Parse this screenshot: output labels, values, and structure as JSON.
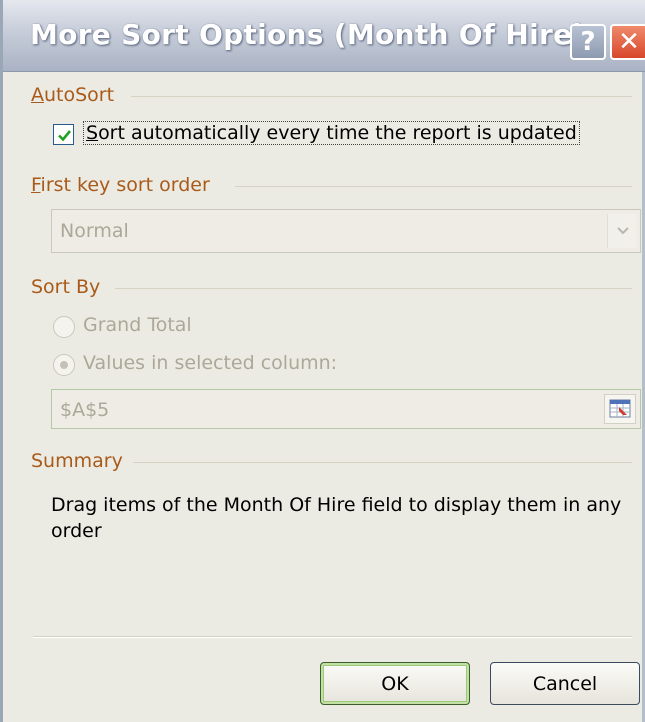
{
  "window": {
    "title": "More Sort Options (Month Of Hire)",
    "help_glyph": "?",
    "close_glyph": "✕"
  },
  "autosort": {
    "group_label_prefix": "",
    "group_label_accel": "A",
    "group_label_rest": "utoSort",
    "checkbox_checked": true,
    "checkbox_label_accel": "S",
    "checkbox_label_rest": "ort automatically every time the report is updated"
  },
  "first_key": {
    "group_label_accel": "F",
    "group_label_rest": "irst key sort order",
    "selected_value": "Normal",
    "disabled": true
  },
  "sort_by": {
    "group_label": "Sort By",
    "options": [
      {
        "label": "Grand Total",
        "selected": false
      },
      {
        "label": "Values in selected column:",
        "selected": true
      }
    ],
    "range_value": "$A$5"
  },
  "summary": {
    "group_label": "Summary",
    "text": "Drag items of the Month Of Hire field to display them in any order"
  },
  "buttons": {
    "ok": "OK",
    "cancel": "Cancel"
  },
  "colors": {
    "group_label": "#a85a1a",
    "disabled_text": "#aca899",
    "close_button": "#d8472a"
  }
}
